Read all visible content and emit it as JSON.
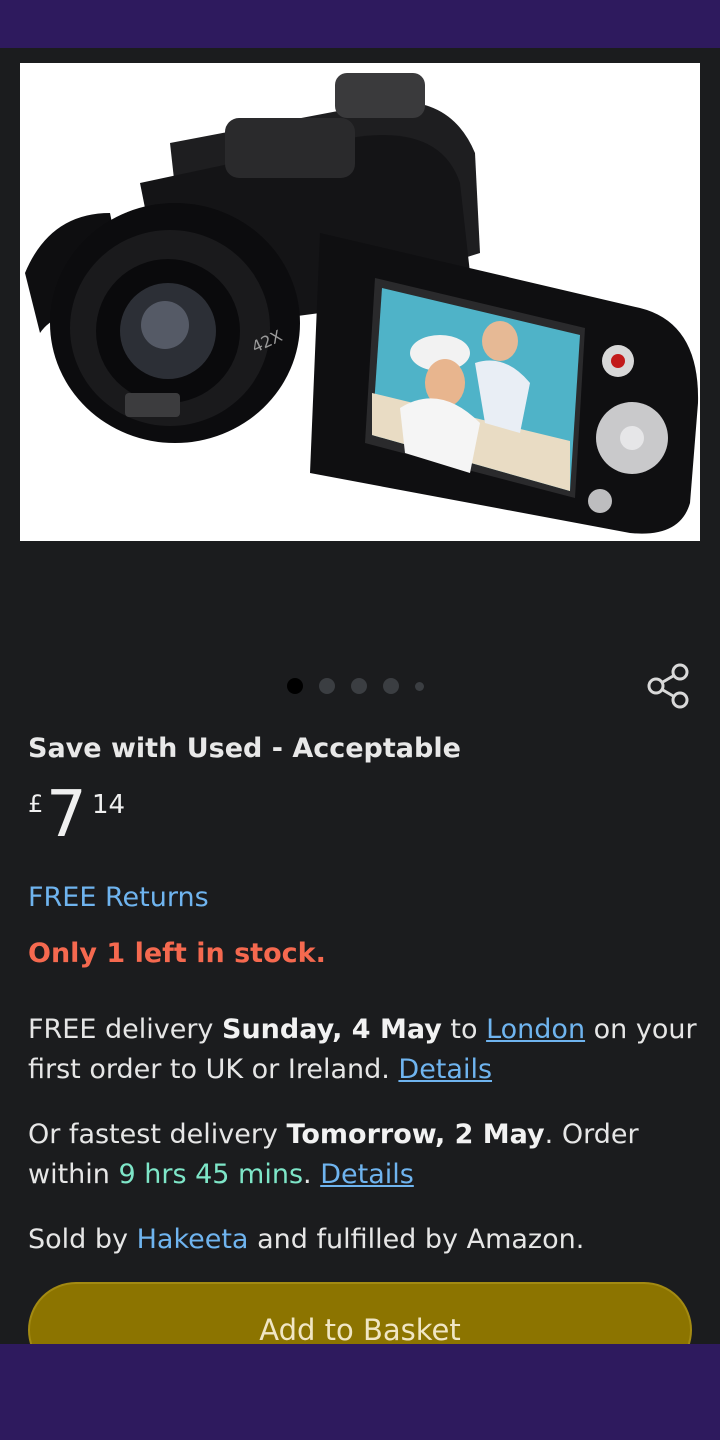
{
  "product": {
    "image_alt": "camcorder",
    "carousel": {
      "count": 5,
      "active_index": 0
    }
  },
  "offer": {
    "title": "Save with Used - Acceptable",
    "price": {
      "currency": "£",
      "whole": "7",
      "fraction": "14"
    },
    "free_returns": "FREE Returns",
    "stock": "Only 1 left in stock."
  },
  "delivery": {
    "line1_prefix": "FREE delivery ",
    "line1_date": "Sunday, 4 May",
    "line1_to": " to ",
    "line1_location": "London",
    "line1_suffix": " on your first order to UK or Ireland. ",
    "details_label": "Details",
    "fast_prefix": "Or fastest delivery ",
    "fast_date": "Tomorrow, 2 May",
    "fast_mid": ". Order within ",
    "fast_countdown": "9 hrs 45 mins",
    "fast_suffix": ". "
  },
  "seller": {
    "prefix": "Sold by ",
    "name": "Hakeeta",
    "suffix": " and fulfilled by Amazon."
  },
  "actions": {
    "add_to_basket": "Add to Basket"
  },
  "colors": {
    "header": "#2e1a5e",
    "accent_button": "#8c7400",
    "link": "#6fb4ef",
    "stock": "#f5694f",
    "countdown": "#7ee6c8"
  },
  "icons": {
    "share": "share-icon"
  }
}
